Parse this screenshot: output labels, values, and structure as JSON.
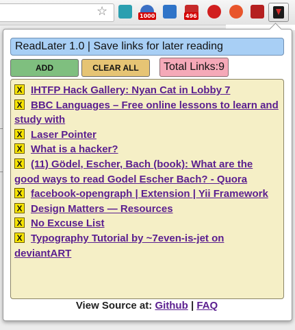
{
  "header": {
    "title": "ReadLater 1.0 | Save links for later reading"
  },
  "buttons": {
    "add_label": "ADD",
    "clear_label": "CLEAR ALL"
  },
  "total": {
    "text": "Total Links:9"
  },
  "links": [
    {
      "label": "IHTFP Hack Gallery: Nyan Cat in Lobby 7"
    },
    {
      "label": "BBC Languages – Free online lessons to learn and study with"
    },
    {
      "label": "Laser Pointer"
    },
    {
      "label": "What is a hacker?"
    },
    {
      "label": "(11) Gödel, Escher, Bach (book): What are the good ways to read Godel Escher Bach? - Quora"
    },
    {
      "label": "facebook-opengraph | Extension | Yii Framework"
    },
    {
      "label": "Design Matters — Resources"
    },
    {
      "label": "No Excuse List"
    },
    {
      "label": "Typography Tutorial by ~7even-is-jet on deviantART"
    }
  ],
  "remove_glyph": "X",
  "footer": {
    "prefix": "View Source at:",
    "github": "Github",
    "separator": "|",
    "faq": "FAQ"
  },
  "toolbar": {
    "badge_1": "1000",
    "badge_2": "496",
    "icons": [
      "bookmark-star-icon",
      "bookmarks-icon",
      "rss-icon",
      "screen-capture-icon",
      "gift-icon",
      "stop-icon",
      "stumbleupon-icon",
      "book-icon",
      "readlater-icon"
    ]
  },
  "colors": {
    "header_bg": "#a8cff5",
    "add_bg": "#7fbf7f",
    "clear_bg": "#e6c474",
    "total_bg": "#f5a9b8",
    "list_bg": "#f5efc6",
    "link": "#5a1e8f",
    "remove_bg": "#f6e400"
  }
}
